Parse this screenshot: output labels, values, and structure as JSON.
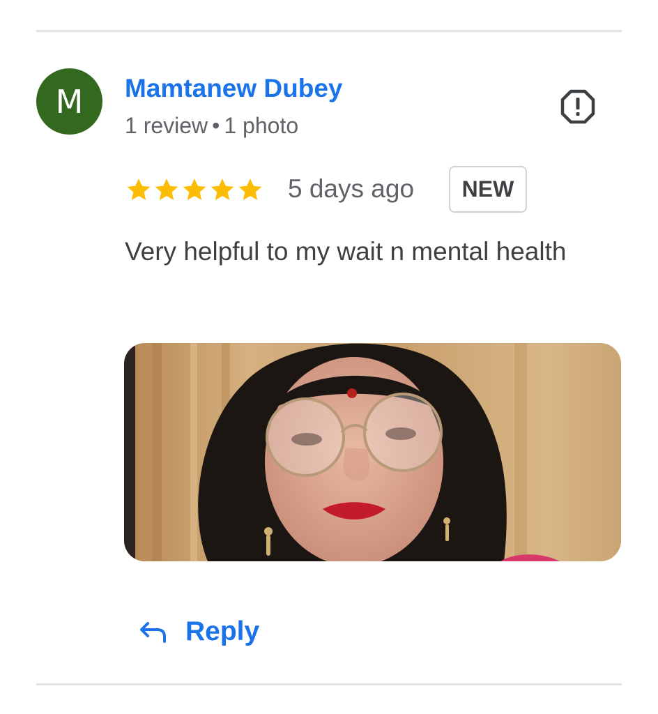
{
  "reviewer": {
    "avatar_letter": "M",
    "avatar_color": "#33691e",
    "name": "Mamtanew Dubey",
    "review_count": "1 review",
    "separator": "•",
    "photo_count": "1 photo"
  },
  "actions": {
    "report_icon": "report-flag-icon"
  },
  "review": {
    "rating": 5,
    "rating_max": 5,
    "date": "5 days ago",
    "badge": "NEW",
    "text": "Very helpful to my wait n mental health",
    "photo_icon": "review-photo"
  },
  "reply": {
    "label": "Reply",
    "icon": "reply-arrow-icon"
  },
  "colors": {
    "link": "#1a73e8",
    "star": "#fbbc04",
    "avatar": "#33691e",
    "divider": "#e3e3e3"
  }
}
